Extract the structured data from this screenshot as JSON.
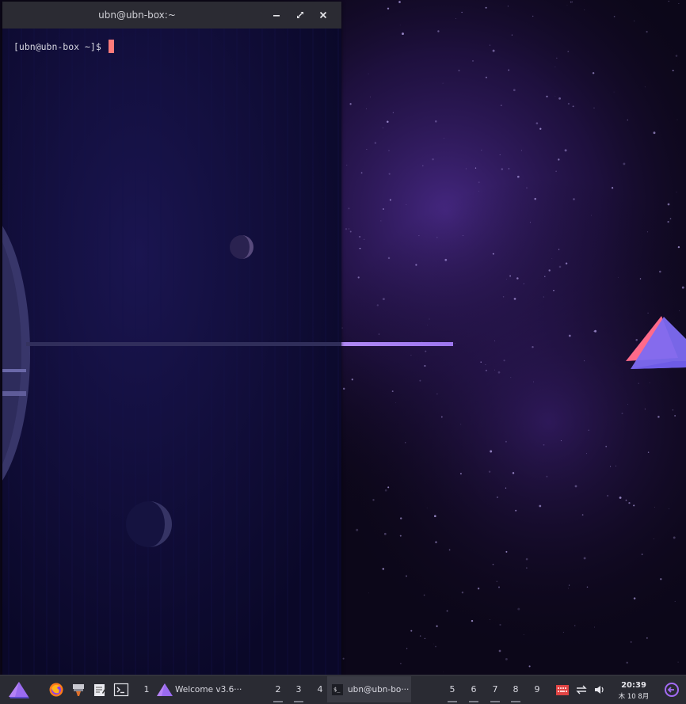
{
  "terminal": {
    "title": "ubn@ubn-box:~",
    "prompt": "[ubn@ubn-box ~]$ ",
    "buttons": {
      "minimize": "minimize-icon",
      "maximize": "maximize-icon",
      "close": "close-icon"
    }
  },
  "taskbar": {
    "launcher_icon": "app-menu-logo-icon",
    "quicklaunch": [
      {
        "name": "firefox-icon"
      },
      {
        "name": "file-manager-icon"
      },
      {
        "name": "text-editor-icon"
      },
      {
        "name": "terminal-launcher-icon"
      }
    ],
    "workspaces_left": [
      "1"
    ],
    "workspaces_mid": [
      "2",
      "3",
      "4"
    ],
    "workspaces_right": [
      "5",
      "6",
      "7",
      "8",
      "9"
    ],
    "tasks": [
      {
        "label": "Welcome v3.6···",
        "icon": "welcome-app-icon"
      },
      {
        "label": "ubn@ubn-bo···",
        "icon": "terminal-icon"
      }
    ],
    "tray": [
      "keyboard-layout-icon",
      "network-icon",
      "volume-icon"
    ],
    "clock": {
      "time": "20:39",
      "date": "木 10 8月"
    },
    "logout_icon": "logout-icon"
  },
  "colors": {
    "accent": "#8b5cf6",
    "taskbar_bg": "#2a2b33",
    "terminal_bg": "#0c0a2e",
    "cursor": "#ff7a7a"
  }
}
